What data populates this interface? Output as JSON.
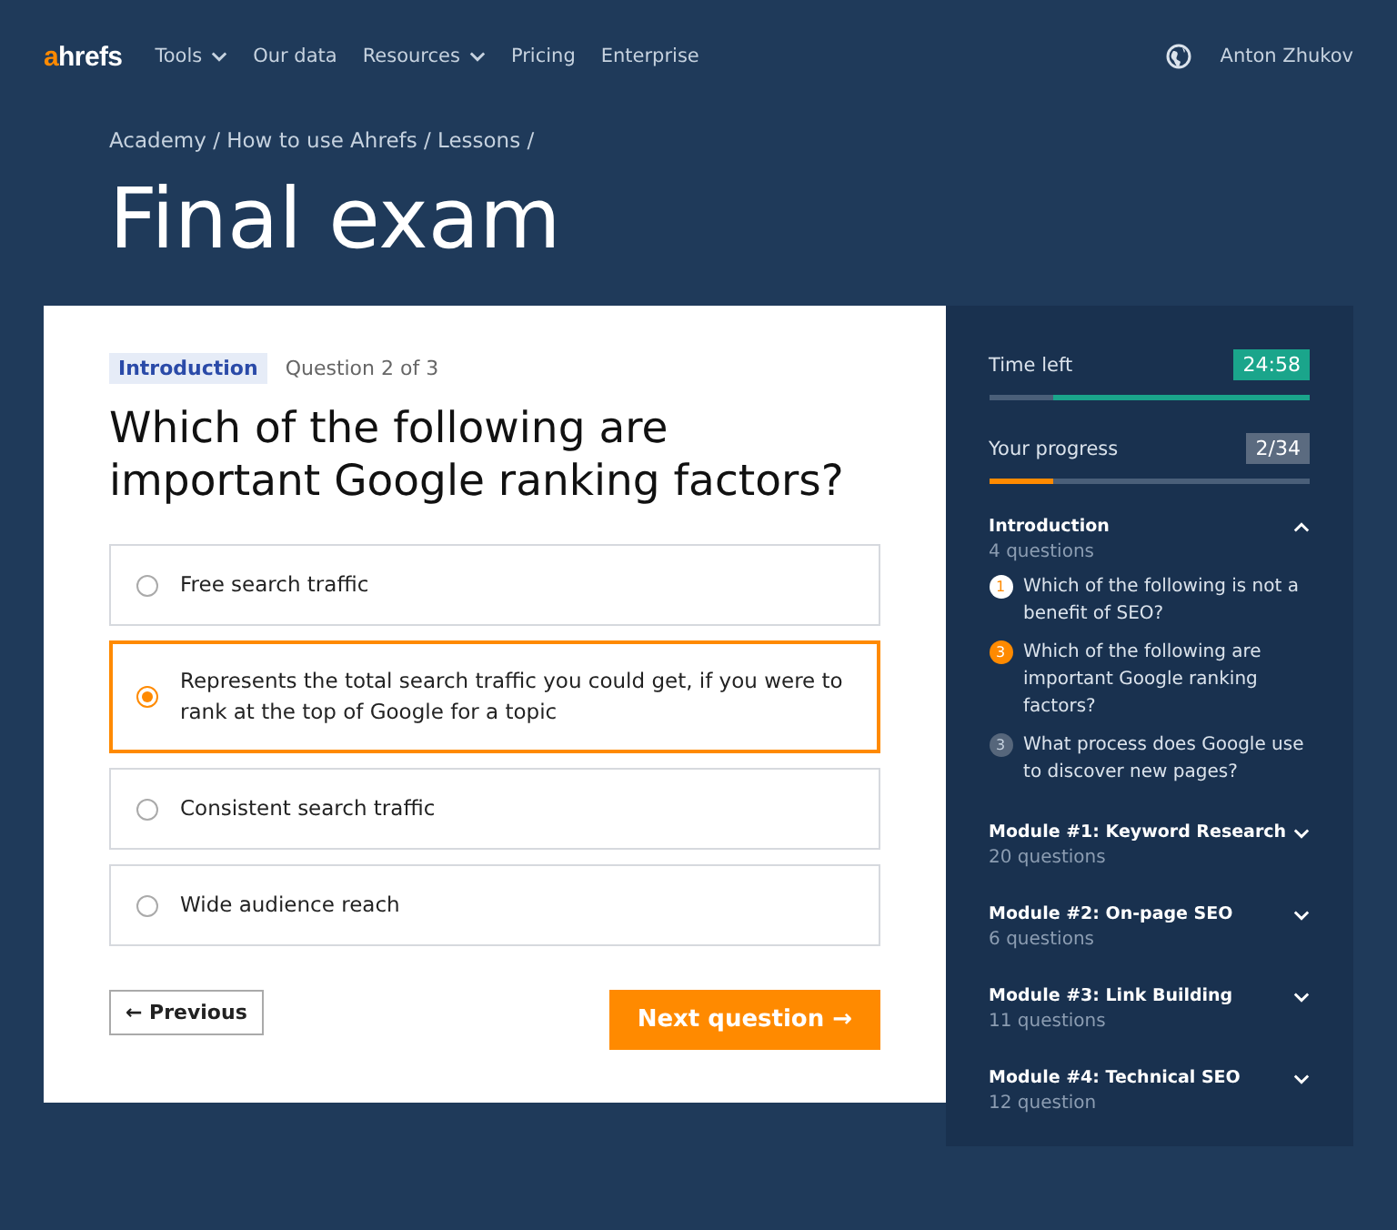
{
  "nav": {
    "logo_accent": "a",
    "logo_rest": "hrefs",
    "items": [
      {
        "label": "Tools",
        "dropdown": true
      },
      {
        "label": "Our data",
        "dropdown": false
      },
      {
        "label": "Resources",
        "dropdown": true
      },
      {
        "label": "Pricing",
        "dropdown": false
      },
      {
        "label": "Enterprise",
        "dropdown": false
      }
    ],
    "user": "Anton Zhukov"
  },
  "breadcrumb": "Academy / How to use Ahrefs / Lessons /",
  "title": "Final exam",
  "question": {
    "tag": "Introduction",
    "counter": "Question 2 of 3",
    "text": "Which of the following are important Google ranking factors?",
    "options": [
      {
        "label": "Free search traffic",
        "selected": false
      },
      {
        "label": "Represents the total search traffic you could get, if you were to rank at the top of Google for a topic",
        "selected": true
      },
      {
        "label": "Consistent search traffic",
        "selected": false
      },
      {
        "label": "Wide audience reach",
        "selected": false
      }
    ],
    "previous": "← Previous",
    "next": "Next question →"
  },
  "sidebar": {
    "timer": {
      "label": "Time left",
      "value": "24:58",
      "level": 0.8
    },
    "progress": {
      "label": "Your progress",
      "value": "2/34",
      "level": 0.2
    },
    "sections": [
      {
        "title": "Introduction",
        "count": "4 questions",
        "expanded": true,
        "questions": [
          {
            "number": "1",
            "text": "Which of the following is not a benefit of SEO?",
            "kind": "done"
          },
          {
            "number": "3",
            "text": "Which of the following are important Google ranking factors?",
            "kind": "current"
          },
          {
            "number": "3",
            "text": "What process does Google use to discover new pages?",
            "kind": "pending"
          }
        ]
      },
      {
        "title": "Module #1: Keyword Research",
        "count": "20 questions",
        "expanded": false
      },
      {
        "title": "Module #2: On-page SEO",
        "count": "6 questions",
        "expanded": false
      },
      {
        "title": "Module #3: Link Building",
        "count": "11 questions",
        "expanded": false
      },
      {
        "title": "Module #4: Technical SEO",
        "count": "12 question",
        "expanded": false
      }
    ]
  }
}
